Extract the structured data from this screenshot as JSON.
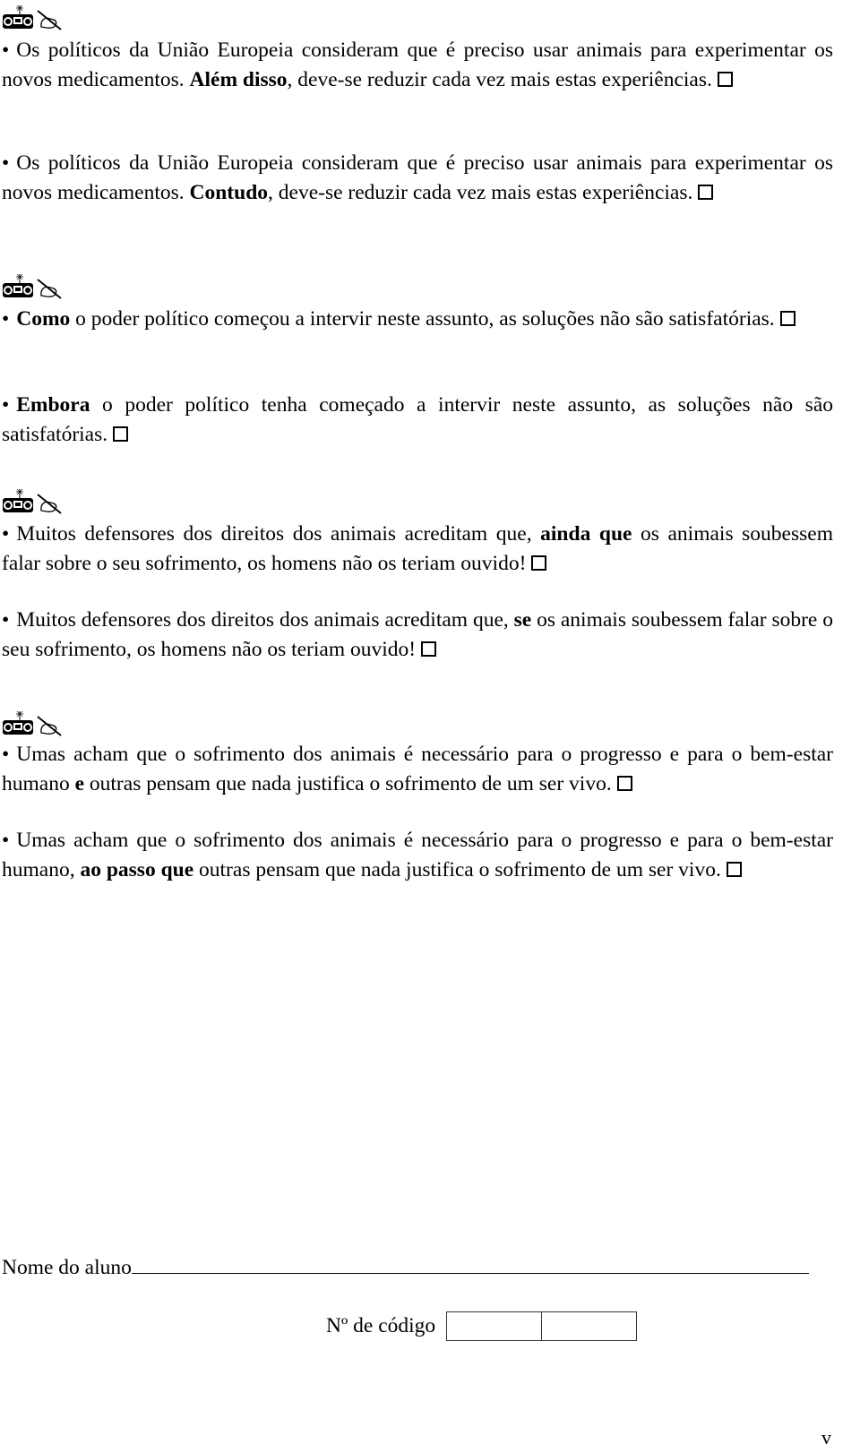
{
  "sections": [
    {
      "icons": [
        "radio-icon",
        "writing-hand-icon"
      ],
      "items": [
        {
          "before": "Os políticos da União Europeia consideram que é preciso usar animais para experimentar os novos medicamentos. ",
          "connective": "Além disso",
          "after": ", deve-se reduzir cada vez mais estas experiências.",
          "checked": false
        },
        {
          "before": "Os políticos da União Europeia consideram que é preciso usar animais para experimentar os novos medicamentos. ",
          "connective": "Contudo",
          "after": ", deve-se reduzir cada vez mais estas experiências.",
          "checked": false
        }
      ]
    },
    {
      "icons": [
        "radio-icon",
        "writing-hand-icon"
      ],
      "items": [
        {
          "before": "",
          "connective": "Como",
          "after": " o poder político começou a intervir neste assunto, as soluções não são satisfatórias.",
          "checked": false
        },
        {
          "before": "",
          "connective": "Embora",
          "after": " o poder político tenha começado a intervir neste assunto, as soluções não são satisfatórias.",
          "checked": false
        }
      ]
    },
    {
      "icons": [
        "radio-icon",
        "writing-hand-icon"
      ],
      "items": [
        {
          "before": "Muitos defensores dos direitos dos animais acreditam que, ",
          "connective": "ainda que",
          "after": " os animais soubessem falar sobre o seu sofrimento, os homens não os teriam ouvido!",
          "checked": false
        },
        {
          "before": "Muitos defensores dos direitos dos animais acreditam que, ",
          "connective": "se",
          "after": " os animais soubessem falar sobre o seu sofrimento, os homens não os teriam ouvido!",
          "checked": false
        }
      ]
    },
    {
      "icons": [
        "radio-icon",
        "writing-hand-icon"
      ],
      "items": [
        {
          "before": "Umas acham que o sofrimento dos animais é necessário para o progresso e para o bem-estar humano ",
          "connective": "e",
          "after": " outras pensam que nada justifica o sofrimento de um ser vivo.",
          "checked": false
        },
        {
          "before": "Umas acham que o sofrimento dos animais é necessário para o progresso e para o bem-estar humano, ",
          "connective": "ao passo que",
          "after": " outras pensam que nada justifica o sofrimento de um ser vivo.",
          "checked": false
        }
      ]
    }
  ],
  "bullet": "•",
  "footer": {
    "name_label": "Nome do aluno",
    "name_value": "",
    "code_label": "Nº de código",
    "code_values": [
      "",
      ""
    ],
    "page_mark": "v"
  }
}
